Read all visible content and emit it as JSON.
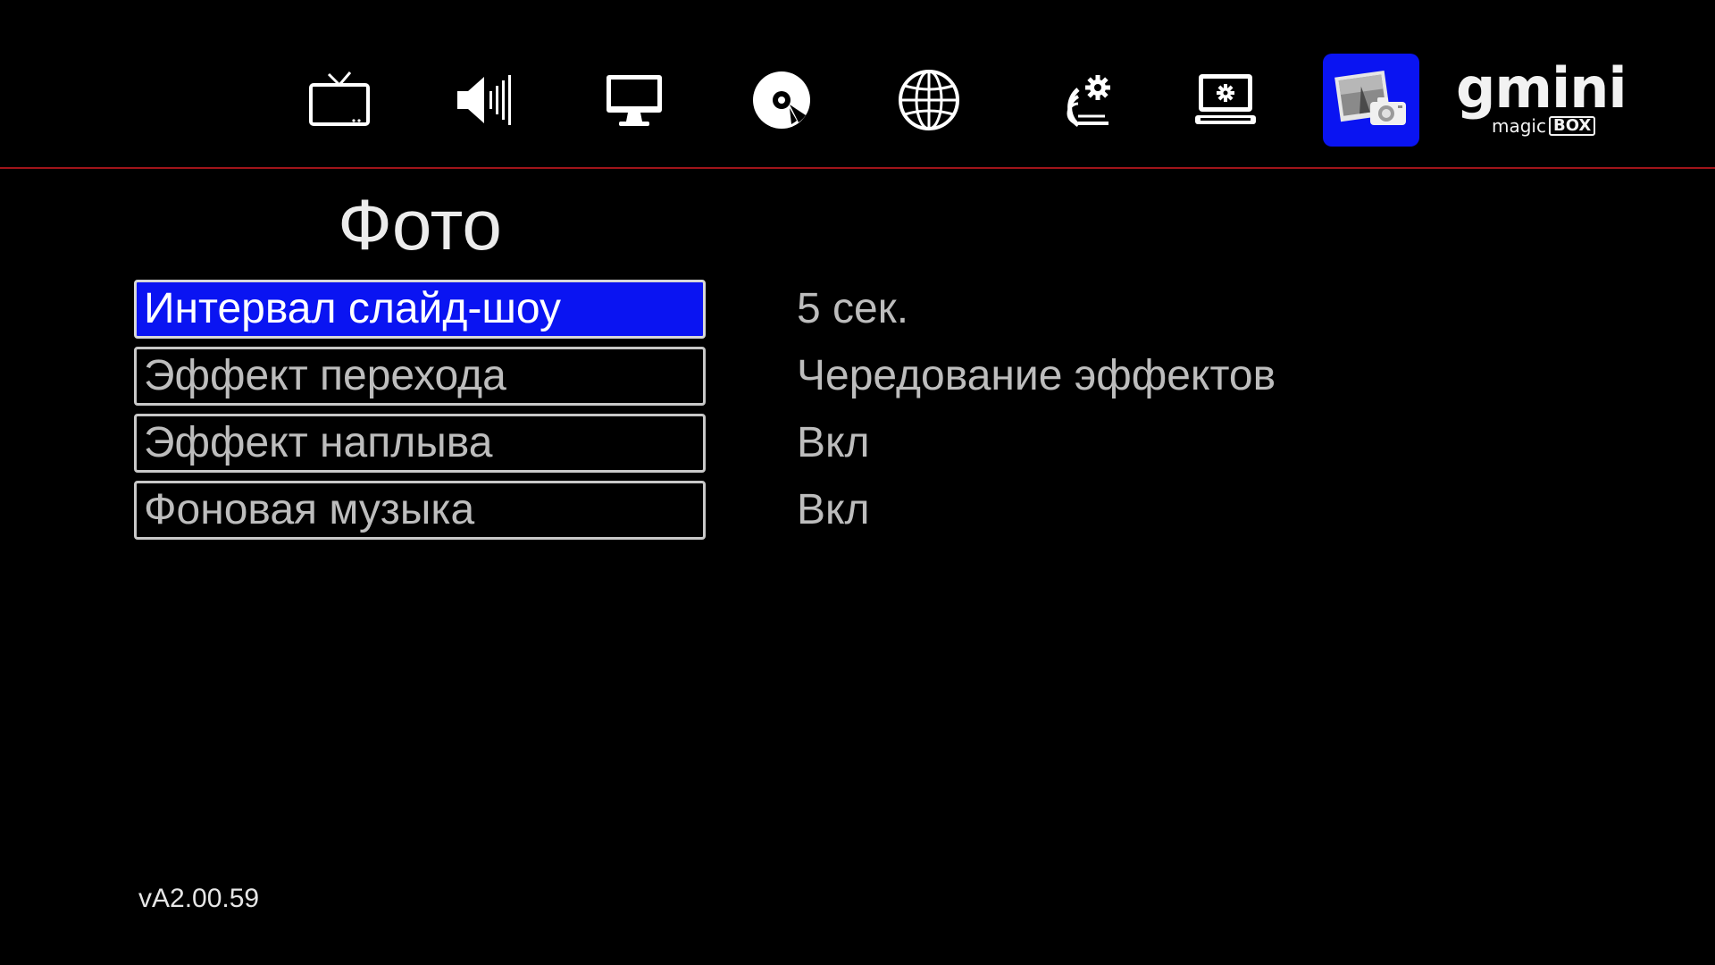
{
  "top_nav": {
    "items": [
      {
        "icon": "tv-icon"
      },
      {
        "icon": "volume-icon"
      },
      {
        "icon": "monitor-icon"
      },
      {
        "icon": "disc-icon"
      },
      {
        "icon": "globe-icon"
      },
      {
        "icon": "system-settings-icon"
      },
      {
        "icon": "display-settings-icon"
      },
      {
        "icon": "photo-camera-icon",
        "active": true
      }
    ],
    "active_color": "#0a14f2",
    "divider_color": "#a0141a"
  },
  "logo": {
    "main": "gmini",
    "sub": "magic",
    "box": "BOX"
  },
  "page": {
    "title": "Фото"
  },
  "settings": [
    {
      "label": "Интервал слайд-шоу",
      "value": "5 сек.",
      "selected": true
    },
    {
      "label": "Эффект перехода",
      "value": "Чередование эффектов",
      "selected": false
    },
    {
      "label": "Эффект наплыва",
      "value": "Вкл",
      "selected": false
    },
    {
      "label": "Фоновая музыка",
      "value": "Вкл",
      "selected": false
    }
  ],
  "footer": {
    "version": "vA2.00.59"
  },
  "colors": {
    "selection": "#0a14f2",
    "text_inactive": "#bdbdbd",
    "text_active": "#ffffff"
  }
}
